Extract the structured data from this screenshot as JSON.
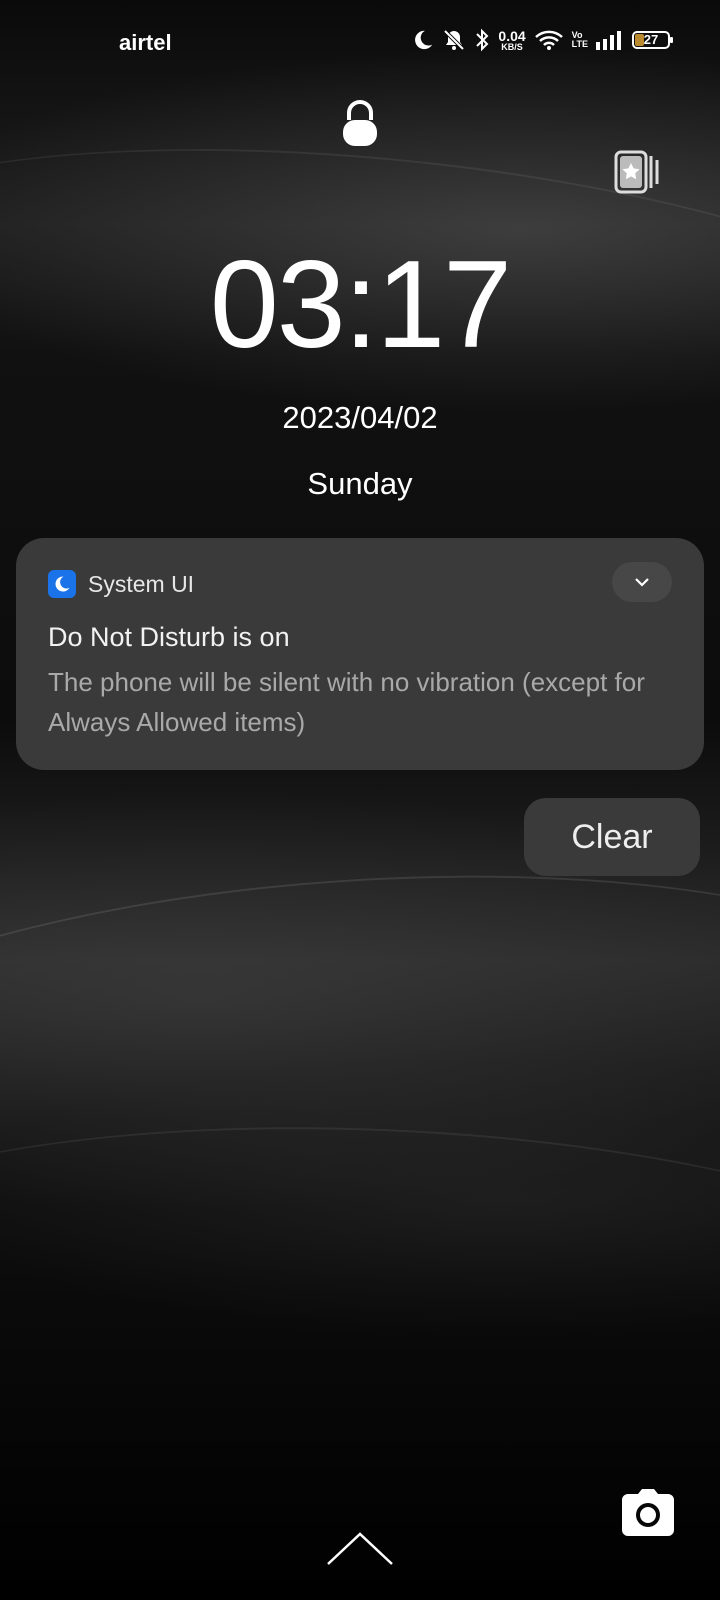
{
  "status_bar": {
    "carrier": "airtel",
    "net_speed_value": "0.04",
    "net_speed_unit": "KB/S",
    "volte_top": "Vo",
    "volte_bottom": "LTE",
    "battery_level": "27",
    "battery_color": "#b98a2e",
    "icons": [
      "moon-icon",
      "bell-off-icon",
      "bluetooth-icon",
      "wifi-icon",
      "signal-icon",
      "battery-icon"
    ]
  },
  "lockscreen": {
    "time": "03:17",
    "date": "2023/04/02",
    "day": "Sunday"
  },
  "notification": {
    "app_name": "System UI",
    "app_icon": "moon-icon",
    "app_icon_color": "#1a73e8",
    "title": "Do Not Disturb is on",
    "body": "The phone will be silent with no vibration (except for Always Allowed items)"
  },
  "actions": {
    "clear_label": "Clear"
  },
  "bottom": {
    "icons": [
      "chevron-up-icon",
      "camera-icon"
    ]
  }
}
